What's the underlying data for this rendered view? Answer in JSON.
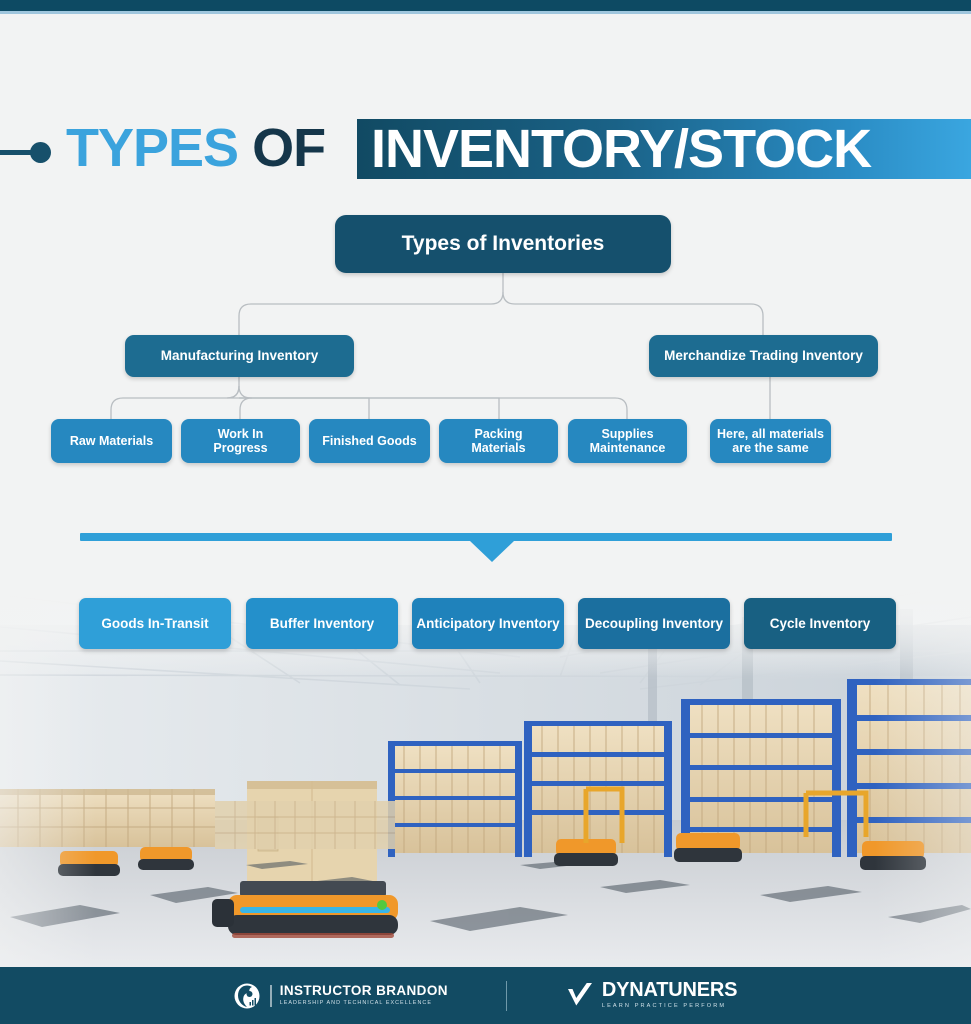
{
  "theme": {
    "bg": "#f2f3f3",
    "dark_teal": "#0d4a63",
    "accent_light_blue": "#9fc6dd",
    "title_blue": "#3ba3dd",
    "title_dark": "#15364a",
    "band_gradient_start": "#114a63",
    "band_gradient_end": "#3aa6e0",
    "node_root": "#15506d",
    "node_level2": "#1d6c91",
    "node_leaf": "#2688c0",
    "divider": "#2f9fd8",
    "footer_bg": "#124b63"
  },
  "header": {
    "title_part1": "TYPES",
    "title_part2": "OF",
    "title_highlight": "INVENTORY/STOCK",
    "bullet_icon": "pin-line-dot-icon"
  },
  "tree": {
    "root": {
      "label": "Types of Inventories"
    },
    "level2": [
      {
        "label": "Manufacturing Inventory"
      },
      {
        "label": "Merchandize Trading Inventory"
      }
    ],
    "leaves": [
      {
        "label": "Raw Materials"
      },
      {
        "label": "Work In\nProgress"
      },
      {
        "label": "Finished Goods"
      },
      {
        "label": "Packing\nMaterials"
      },
      {
        "label": "Supplies\nMaintenance"
      },
      {
        "label": "Here, all materials\nare the same"
      }
    ]
  },
  "divider": {
    "arrow_icon": "chevron-down-triangle-icon"
  },
  "flow": {
    "steps": [
      {
        "label": "Goods In-Transit"
      },
      {
        "label": "Buffer Inventory"
      },
      {
        "label": "Anticipatory Inventory"
      },
      {
        "label": "Decoupling Inventory"
      },
      {
        "label": "Cycle Inventory"
      }
    ],
    "connector_icon": "chevron-right-arrow-icon"
  },
  "photo": {
    "alt": "warehouse-interior-with-pallet-racks-cartons-and-autonomous-robots"
  },
  "footer": {
    "brand1": {
      "name": "INSTRUCTOR BRANDON",
      "tagline": "LEADERSHIP AND TECHNICAL EXCELLENCE",
      "logo_icon": "instructor-brandon-circle-logo-icon"
    },
    "brand2": {
      "name": "DYNATUNERS",
      "tagline": "LEARN PRACTICE PERFORM",
      "logo_icon": "dynatuners-checkmark-logo-icon"
    }
  }
}
